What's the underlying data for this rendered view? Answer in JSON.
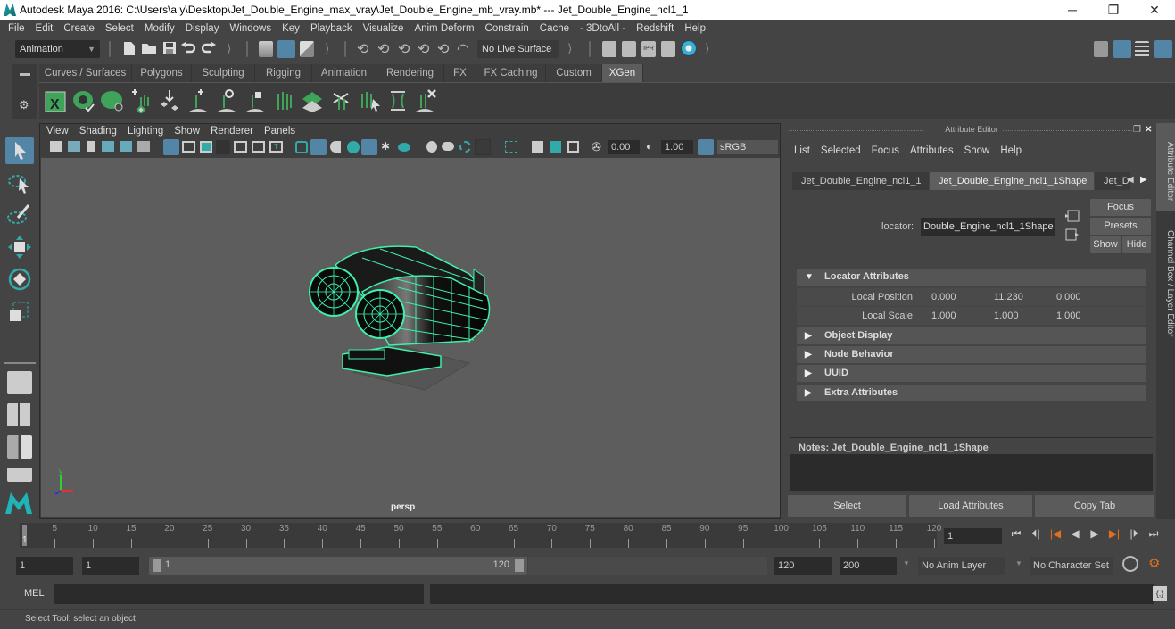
{
  "window": {
    "title": "Autodesk Maya 2016: C:\\Users\\a y\\Desktop\\Jet_Double_Engine_max_vray\\Jet_Double_Engine_mb_vray.mb*   ---   Jet_Double_Engine_ncl1_1",
    "minimize": "─",
    "maximize": "❐",
    "close": "✕"
  },
  "menubar": [
    "File",
    "Edit",
    "Create",
    "Select",
    "Modify",
    "Display",
    "Windows",
    "Key",
    "Playback",
    "Visualize",
    "Anim Deform",
    "Constrain",
    "Cache",
    "- 3DtoAll -",
    "Redshift",
    "Help"
  ],
  "toolbar": {
    "mode": "Animation",
    "live_surface": "No Live Surface"
  },
  "shelf": {
    "tabs": [
      "Curves / Surfaces",
      "Polygons",
      "Sculpting",
      "Rigging",
      "Animation",
      "Rendering",
      "FX",
      "FX Caching",
      "Custom",
      "XGen"
    ],
    "active_tab": "XGen",
    "icons": [
      "xgen-editor-icon",
      "create-description-icon",
      "hide-description-icon",
      "add-guides-icon",
      "sculpt-guides-icon",
      "add-guide-icon",
      "rotate-guide-icon",
      "lock-guide-icon",
      "guides-to-curves-icon",
      "grid-patch-icon",
      "groom-tool-icon",
      "select-guide-icon",
      "guide-bounds-icon",
      "delete-guide-icon"
    ]
  },
  "left_tools": [
    "select-tool-icon",
    "lasso-tool-icon",
    "paint-select-icon",
    "move-tool-icon",
    "rotate-tool-icon",
    "scale-tool-icon"
  ],
  "viewport": {
    "menu": [
      "View",
      "Shading",
      "Lighting",
      "Show",
      "Renderer",
      "Panels"
    ],
    "near": "0.00",
    "far": "1.00",
    "color_space": "sRGB gamma",
    "camera_label": "persp",
    "axis": {
      "x": "x",
      "y": "y",
      "z": "z"
    }
  },
  "attribute_editor": {
    "title": "Attribute Editor",
    "menu": [
      "List",
      "Selected",
      "Focus",
      "Attributes",
      "Show",
      "Help"
    ],
    "tabs": [
      "Jet_Double_Engine_ncl1_1",
      "Jet_Double_Engine_ncl1_1Shape",
      "Jet_D"
    ],
    "active_tab": "Jet_Double_Engine_ncl1_1Shape",
    "node_type_label": "locator:",
    "node_name": "Double_Engine_ncl1_1Shape",
    "buttons": {
      "focus": "Focus",
      "presets": "Presets",
      "show": "Show",
      "hide": "Hide"
    },
    "sections": [
      {
        "label": "Locator Attributes",
        "expanded": true
      },
      {
        "label": "Object Display",
        "expanded": false
      },
      {
        "label": "Node Behavior",
        "expanded": false
      },
      {
        "label": "UUID",
        "expanded": false
      },
      {
        "label": "Extra Attributes",
        "expanded": false
      }
    ],
    "attributes": [
      {
        "label": "Local Position",
        "values": [
          "0.000",
          "11.230",
          "0.000"
        ]
      },
      {
        "label": "Local Scale",
        "values": [
          "1.000",
          "1.000",
          "1.000"
        ]
      }
    ],
    "notes_label": "Notes:  Jet_Double_Engine_ncl1_1Shape",
    "notes_value": "",
    "bottom_buttons": [
      "Select",
      "Load Attributes",
      "Copy Tab"
    ]
  },
  "side_tabs": [
    "Attribute Editor",
    "Channel Box / Layer Editor"
  ],
  "timeline": {
    "ticks": [
      5,
      10,
      15,
      20,
      25,
      30,
      35,
      40,
      45,
      50,
      55,
      60,
      65,
      70,
      75,
      80,
      85,
      90,
      95,
      100,
      105,
      110,
      115,
      120
    ],
    "start": 1,
    "end": 120,
    "current_frame_label": "1",
    "current_frame": "1"
  },
  "range": {
    "start_time": "1",
    "playback_start": "1",
    "slider_start": "1",
    "slider_end": "120",
    "playback_end": "120",
    "end_time": "200",
    "anim_layer": "No Anim Layer",
    "character_set": "No Character Set"
  },
  "command_line": {
    "language": "MEL",
    "input": "",
    "result": ""
  },
  "status_line": "Select Tool: select an object",
  "colors": {
    "accent": "#5285a6",
    "wireframe": "#3ef0a8",
    "keyframe": "#e07020",
    "xgen_green": "#3fa35a"
  }
}
